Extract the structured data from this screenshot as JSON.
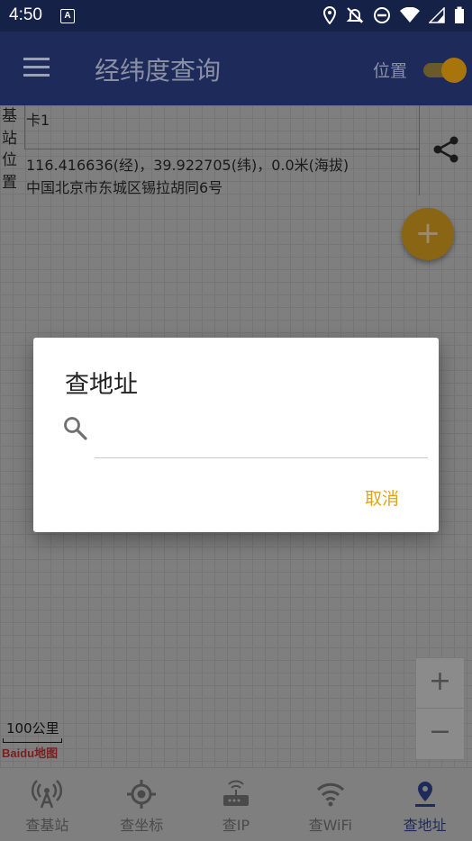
{
  "status_bar": {
    "time": "4:50",
    "icons": [
      "a-notification-icon",
      "location-icon",
      "notifications-off-icon",
      "do-not-disturb-icon",
      "wifi-icon",
      "signal-icon",
      "battery-icon"
    ]
  },
  "app_bar": {
    "title": "经纬度查询",
    "location_label": "位置",
    "location_toggle": true
  },
  "info_panel": {
    "base_station_label": "基站",
    "base_station_value": "卡1",
    "position_label": "位置",
    "coordinates": "116.416636(经)，39.922705(纬)，0.0米(海拔)",
    "address": "中国北京市东城区锡拉胡同6号"
  },
  "map": {
    "scale_label": "100公里",
    "logo_text": "Baidu地图",
    "zoom_in": "+",
    "zoom_out": "−"
  },
  "dialog": {
    "title": "查地址",
    "search_value": "",
    "search_placeholder": "",
    "cancel_label": "取消"
  },
  "bottom_nav": {
    "tabs": [
      {
        "label": "查基站",
        "icon": "antenna-icon"
      },
      {
        "label": "查坐标",
        "icon": "gps-crosshair-icon"
      },
      {
        "label": "查IP",
        "icon": "router-icon"
      },
      {
        "label": "查WiFi",
        "icon": "wifi-icon"
      },
      {
        "label": "查地址",
        "icon": "map-pin-icon"
      }
    ],
    "active_index": 4
  },
  "colors": {
    "primary": "#1e2b5a",
    "accent": "#e6a317",
    "status_bar": "#162147"
  }
}
